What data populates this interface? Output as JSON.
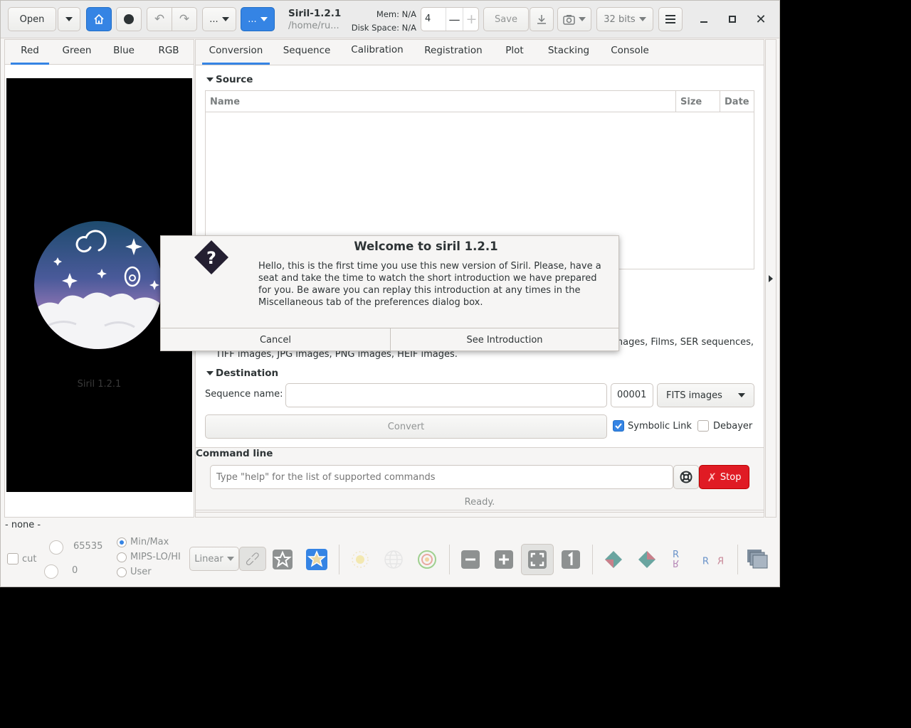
{
  "header": {
    "open_label": "Open",
    "script_label": "...",
    "script2_label": "...",
    "app_title": "Siril-1.2.1",
    "working_dir": "/home/ru...",
    "mem_label": "Mem: N/A",
    "disk_label": "Disk Space: N/A",
    "threads_value": "4",
    "save_label": "Save",
    "bits_label": "32 bits"
  },
  "left_tabs": [
    "Red",
    "Green",
    "Blue",
    "RGB"
  ],
  "main_tabs": [
    "Conversion",
    "Sequence",
    "Calibration",
    "Registration",
    "Plot",
    "Stacking",
    "Console"
  ],
  "source": {
    "title": "Source",
    "columns": [
      "Name",
      "Size",
      "Date"
    ]
  },
  "supported_text_line1": "nages, Films, SER sequences,",
  "supported_text_line2": "TIFF images, JPG images, PNG images, HEIF images.",
  "destination": {
    "title": "Destination",
    "sequence_label": "Sequence name:",
    "sequence_value": "",
    "start_index": "00001",
    "format": "FITS images",
    "convert_label": "Convert",
    "symlink_label": "Symbolic Link",
    "debayer_label": "Debayer"
  },
  "command": {
    "title": "Command line",
    "placeholder": "Type \"help\" for the list of supported commands",
    "stop_label": "Stop",
    "status": "Ready."
  },
  "preview": {
    "caption": "Siril 1.2.1"
  },
  "bottom": {
    "file_label": "- none -",
    "cut_label": "cut",
    "high_value": "65535",
    "low_value": "0",
    "range_options": [
      "Min/Max",
      "MIPS-LO/HI",
      "User"
    ],
    "scale_label": "Linear"
  },
  "dialog": {
    "title": "Welcome to siril 1.2.1",
    "message": "Hello, this is the first time you use this new version of Siril. Please, have a seat and take the time to watch the short introduction we have prepared for you. Be aware you can replay this introduction at any times in the Miscellaneous tab of the preferences dialog box.",
    "cancel_label": "Cancel",
    "intro_label": "See Introduction"
  },
  "colors": {
    "accent": "#3584e4",
    "stop": "#e01b24",
    "window_bg": "#f6f5f4"
  }
}
